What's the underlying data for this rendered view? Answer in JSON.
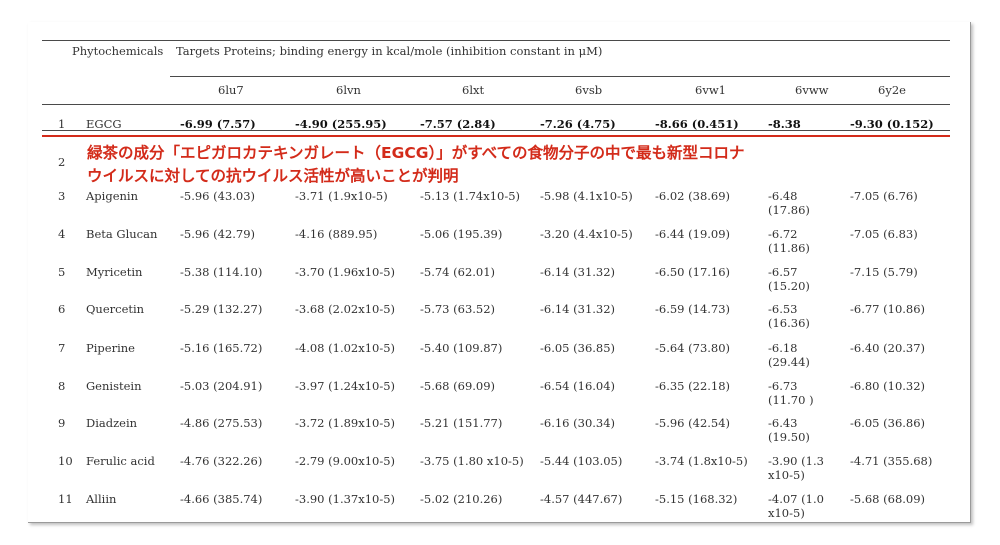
{
  "table": {
    "phyto_header": "Phytochemicals",
    "targets_header": "Targets Proteins; binding energy in kcal/mole (inhibition constant in μM)",
    "columns": [
      "6lu7",
      "6lvn",
      "6lxt",
      "6vsb",
      "6vw1",
      "6vww",
      "6y2e"
    ],
    "rows": [
      {
        "num": "1",
        "name": "EGCG",
        "cells": [
          "-6.99 (7.57)",
          "-4.90 (255.95)",
          "-7.57 (2.84)",
          "-7.26 (4.75)",
          "-8.66 (0.451)",
          "-8.38",
          "-9.30 (0.152)"
        ]
      },
      {
        "num": "2",
        "name": "",
        "cells": [
          "",
          "",
          "",
          "",
          "",
          "",
          ""
        ]
      },
      {
        "num": "3",
        "name": "Apigenin",
        "cells": [
          "-5.96 (43.03)",
          "-3.71 (1.9x10-5)",
          "-5.13 (1.74x10-5)",
          "-5.98 (4.1x10-5)",
          "-6.02 (38.69)",
          "-6.48 (17.86)",
          "-7.05 (6.76)"
        ]
      },
      {
        "num": "4",
        "name": "Beta Glucan",
        "cells": [
          "-5.96 (42.79)",
          "-4.16 (889.95)",
          "-5.06 (195.39)",
          "-3.20 (4.4x10-5)",
          "-6.44 (19.09)",
          "-6.72 (11.86)",
          "-7.05 (6.83)"
        ]
      },
      {
        "num": "5",
        "name": "Myricetin",
        "cells": [
          "-5.38 (114.10)",
          "-3.70 (1.96x10-5)",
          "-5.74 (62.01)",
          "-6.14 (31.32)",
          "-6.50 (17.16)",
          "-6.57 (15.20)",
          "-7.15 (5.79)"
        ]
      },
      {
        "num": "6",
        "name": "Quercetin",
        "cells": [
          "-5.29 (132.27)",
          "-3.68 (2.02x10-5)",
          "-5.73 (63.52)",
          "-6.14 (31.32)",
          "-6.59 (14.73)",
          "-6.53 (16.36)",
          "-6.77 (10.86)"
        ]
      },
      {
        "num": "7",
        "name": "Piperine",
        "cells": [
          "-5.16 (165.72)",
          "-4.08 (1.02x10-5)",
          "-5.40 (109.87)",
          "-6.05 (36.85)",
          "-5.64 (73.80)",
          "-6.18 (29.44)",
          "-6.40 (20.37)"
        ]
      },
      {
        "num": "8",
        "name": "Genistein",
        "cells": [
          "-5.03 (204.91)",
          "-3.97 (1.24x10-5)",
          "-5.68 (69.09)",
          "-6.54 (16.04)",
          "-6.35 (22.18)",
          "-6.73 (11.70 )",
          "-6.80 (10.32)"
        ]
      },
      {
        "num": "9",
        "name": "Diadzein",
        "cells": [
          "-4.86 (275.53)",
          "-3.72 (1.89x10-5)",
          "-5.21 (151.77)",
          "-6.16 (30.34)",
          "-5.96 (42.54)",
          "-6.43 (19.50)",
          "-6.05 (36.86)"
        ]
      },
      {
        "num": "10",
        "name": "Ferulic acid",
        "cells": [
          "-4.76 (322.26)",
          "-2.79 (9.00x10-5)",
          "-3.75 (1.80 x10-5)",
          "-5.44 (103.05)",
          "-3.74 (1.8x10-5)",
          "-3.90 (1.3 x10-5)",
          "-4.71 (355.68)"
        ]
      },
      {
        "num": "11",
        "name": "Alliin",
        "cells": [
          "-4.66 (385.74)",
          "-3.90 (1.37x10-5)",
          "-5.02 (210.26)",
          "-4.57 (447.67)",
          "-5.15 (168.32)",
          "-4.07 (1.0 x10-5)",
          "-5.68 (68.09)"
        ]
      }
    ]
  },
  "overlay": {
    "line1": "緑茶の成分「エピガロカテキンガレート（EGCG）」がすべての食物分子の中で最も新型コロナ",
    "line2": "ウイルスに対しての抗ウイルス活性が高いことが判明"
  },
  "colors": {
    "overlay_text": "#d32b1a",
    "rule": "#4a4a4a",
    "accent_line": "#d32b1a"
  }
}
